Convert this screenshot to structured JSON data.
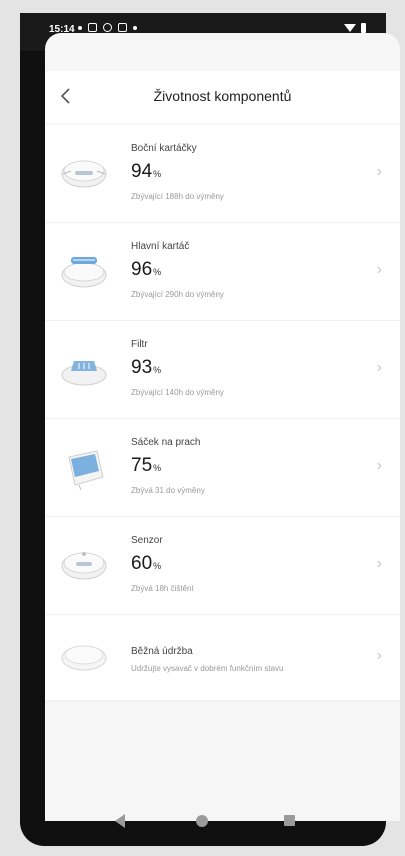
{
  "status": {
    "time": "15:14"
  },
  "header": {
    "title": "Životnost komponentů"
  },
  "components": [
    {
      "name": "Boční kartáčky",
      "value": "94",
      "unit": "%",
      "sub": "Zbývající 188h do výměny",
      "icon": "side-brush-icon"
    },
    {
      "name": "Hlavní kartáč",
      "value": "96",
      "unit": "%",
      "sub": "Zbývající 290h do výměny",
      "icon": "main-brush-icon"
    },
    {
      "name": "Filtr",
      "value": "93",
      "unit": "%",
      "sub": "Zbývající 140h do výměny",
      "icon": "filter-icon"
    },
    {
      "name": "Sáček na prach",
      "value": "75",
      "unit": "%",
      "sub": "Zbývá 31 do výměny",
      "icon": "dust-bag-icon"
    },
    {
      "name": "Senzor",
      "value": "60",
      "unit": "%",
      "sub": "Zbývá 18h čištění",
      "icon": "sensor-icon"
    },
    {
      "name": "Běžná údržba",
      "sub": "Udržujte vysavač v dobrém funkčním stavu",
      "icon": "maintenance-icon"
    }
  ],
  "colors": {
    "background": "#f6f6f6",
    "card": "#ffffff",
    "accent_blue": "#6fa8dc"
  }
}
